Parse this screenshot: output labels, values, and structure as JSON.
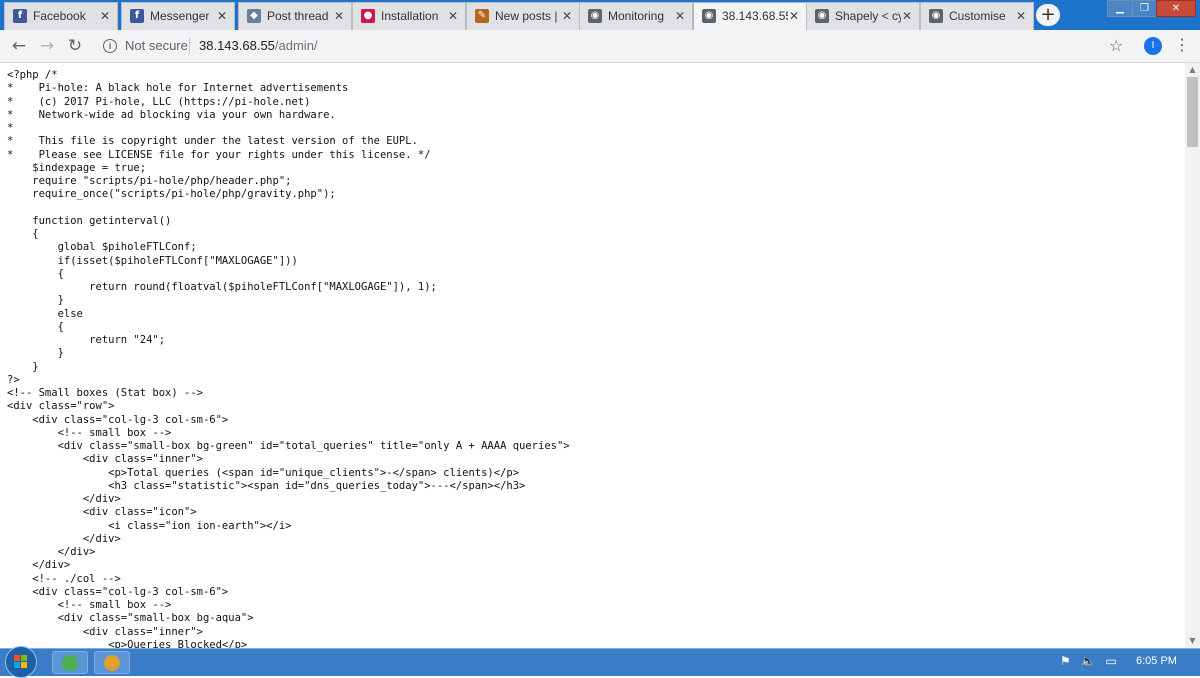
{
  "browser": {
    "tabs": [
      {
        "title": "Facebook",
        "icon": "facebook-icon",
        "color": "#3b5998",
        "glyph": "f"
      },
      {
        "title": "Messenger",
        "icon": "facebook-icon",
        "color": "#3b5998",
        "glyph": "f"
      },
      {
        "title": "Post thread",
        "icon": "shield-icon",
        "color": "#6a7f9a",
        "glyph": "◆"
      },
      {
        "title": "Installation",
        "icon": "raspberry-icon",
        "color": "#c51a4a",
        "glyph": "●"
      },
      {
        "title": "New posts |",
        "icon": "forum-icon",
        "color": "#b5651d",
        "glyph": "✎"
      },
      {
        "title": "Monitoring",
        "icon": "globe-icon",
        "color": "#5f6368",
        "glyph": "◉"
      },
      {
        "title": "38.143.68.55",
        "icon": "globe-icon",
        "color": "#5f6368",
        "glyph": "◉",
        "active": true
      },
      {
        "title": "Shapely < cy",
        "icon": "globe-icon",
        "color": "#5f6368",
        "glyph": "◉"
      },
      {
        "title": "Customise",
        "icon": "globe-icon",
        "color": "#5f6368",
        "glyph": "◉"
      }
    ],
    "address_bar": {
      "security_label": "Not secure",
      "host": "38.143.68.55",
      "path": "/admin/"
    },
    "avatar_letter": "I"
  },
  "page": {
    "code_lines": [
      "<?php /*",
      "*    Pi-hole: A black hole for Internet advertisements",
      "*    (c) 2017 Pi-hole, LLC (https://pi-hole.net)",
      "*    Network-wide ad blocking via your own hardware.",
      "*",
      "*    This file is copyright under the latest version of the EUPL.",
      "*    Please see LICENSE file for your rights under this license. */",
      "    $indexpage = true;",
      "    require \"scripts/pi-hole/php/header.php\";",
      "    require_once(\"scripts/pi-hole/php/gravity.php\");",
      "",
      "    function getinterval()",
      "    {",
      "        global $piholeFTLConf;",
      "        if(isset($piholeFTLConf[\"MAXLOGAGE\"]))",
      "        {",
      "             return round(floatval($piholeFTLConf[\"MAXLOGAGE\"]), 1);",
      "        }",
      "        else",
      "        {",
      "             return \"24\";",
      "        }",
      "    }",
      "?>",
      "<!-- Small boxes (Stat box) -->",
      "<div class=\"row\">",
      "    <div class=\"col-lg-3 col-sm-6\">",
      "        <!-- small box -->",
      "        <div class=\"small-box bg-green\" id=\"total_queries\" title=\"only A + AAAA queries\">",
      "            <div class=\"inner\">",
      "                <p>Total queries (<span id=\"unique_clients\">-</span> clients)</p>",
      "                <h3 class=\"statistic\"><span id=\"dns_queries_today\">---</span></h3>",
      "            </div>",
      "            <div class=\"icon\">",
      "                <i class=\"ion ion-earth\"></i>",
      "            </div>",
      "        </div>",
      "    </div>",
      "    <!-- ./col -->",
      "    <div class=\"col-lg-3 col-sm-6\">",
      "        <!-- small box -->",
      "        <div class=\"small-box bg-aqua\">",
      "            <div class=\"inner\">",
      "                <p>Queries Blocked</p>"
    ]
  },
  "taskbar": {
    "apps": [
      {
        "name": "chrome-taskbar-icon",
        "color": "#4caf50"
      },
      {
        "name": "paint-taskbar-icon",
        "color": "#e0a030"
      }
    ],
    "clock": "6:05 PM"
  }
}
